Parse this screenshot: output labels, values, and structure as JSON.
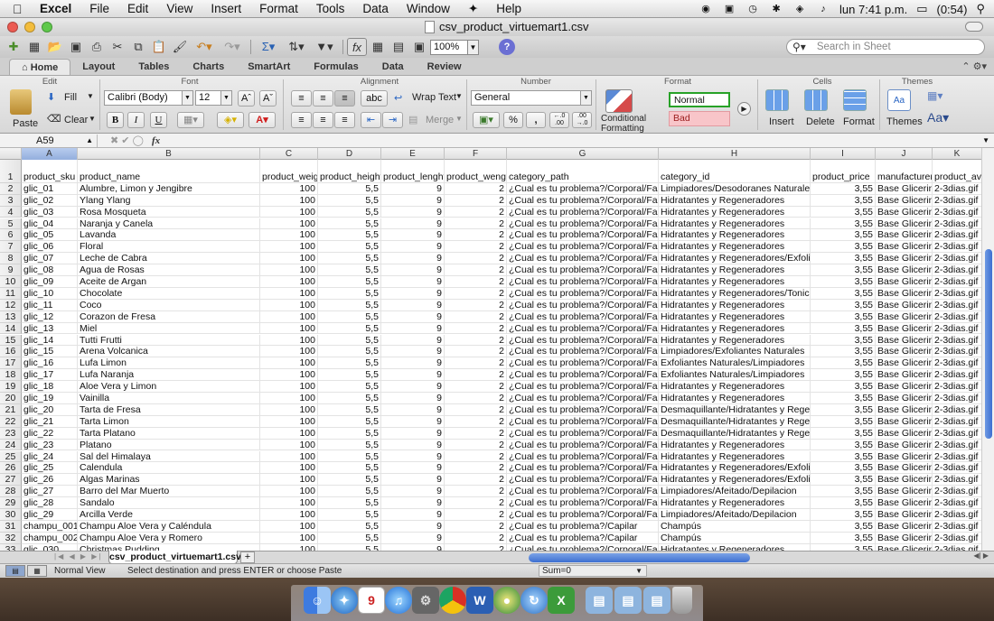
{
  "menubar": {
    "app": "Excel",
    "menus": [
      "File",
      "Edit",
      "View",
      "Insert",
      "Format",
      "Tools",
      "Data",
      "Window",
      "Help"
    ],
    "clock": "lun 7:41 p.m.",
    "battery": "(0:54)"
  },
  "window": {
    "title": "csv_product_virtuemart1.csv"
  },
  "standard_toolbar": {
    "zoom": "100%",
    "search_placeholder": "Search in Sheet"
  },
  "ribbon_tabs": [
    "Home",
    "Layout",
    "Tables",
    "Charts",
    "SmartArt",
    "Formulas",
    "Data",
    "Review"
  ],
  "ribbon": {
    "groups": {
      "edit": "Edit",
      "font": "Font",
      "alignment": "Alignment",
      "number": "Number",
      "format": "Format",
      "cells": "Cells",
      "themes": "Themes"
    },
    "paste": "Paste",
    "fill": "Fill",
    "clear": "Clear",
    "font_name": "Calibri (Body)",
    "font_size": "12",
    "bold": "B",
    "italic": "I",
    "underline": "U",
    "wrap_text": "Wrap Text",
    "merge": "Merge",
    "abc": "abc",
    "number_format": "General",
    "percent": "%",
    "comma": ",",
    "cond_format_line1": "Conditional",
    "cond_format_line2": "Formatting",
    "style_normal": "Normal",
    "style_bad": "Bad",
    "insert": "Insert",
    "delete": "Delete",
    "format": "Format",
    "themes": "Themes"
  },
  "formula_bar": {
    "name_box": "A59",
    "fx": "fx",
    "content": ""
  },
  "columns": [
    {
      "letter": "A",
      "header": "product_sku"
    },
    {
      "letter": "B",
      "header": "product_name"
    },
    {
      "letter": "C",
      "header": "product_weigh"
    },
    {
      "letter": "D",
      "header": "product_height"
    },
    {
      "letter": "E",
      "header": "product_lenght"
    },
    {
      "letter": "F",
      "header": "product_wengh"
    },
    {
      "letter": "G",
      "header": "category_path"
    },
    {
      "letter": "H",
      "header": "category_id"
    },
    {
      "letter": "I",
      "header": "product_price"
    },
    {
      "letter": "J",
      "header": "manufacturer_"
    },
    {
      "letter": "K",
      "header": "product_ava"
    }
  ],
  "rows": [
    [
      "glic_01",
      "Alumbre, Limon y Jengibre",
      "100",
      "5,5",
      "9",
      "2",
      "¿Cual es tu problema?/Corporal/Facial",
      "Limpiadores/Desodoranes Naturales",
      "3,55",
      "Base Glicerina",
      "2-3dias.gif"
    ],
    [
      "glic_02",
      "Ylang Ylang",
      "100",
      "5,5",
      "9",
      "2",
      "¿Cual es tu problema?/Corporal/Facial",
      "Hidratantes y Regeneradores",
      "3,55",
      "Base Glicerina",
      "2-3dias.gif"
    ],
    [
      "glic_03",
      "Rosa Mosqueta",
      "100",
      "5,5",
      "9",
      "2",
      "¿Cual es tu problema?/Corporal/Facial",
      "Hidratantes y Regeneradores",
      "3,55",
      "Base Glicerina",
      "2-3dias.gif"
    ],
    [
      "glic_04",
      "Naranja y Canela",
      "100",
      "5,5",
      "9",
      "2",
      "¿Cual es tu problema?/Corporal/Facial",
      "Hidratantes y Regeneradores",
      "3,55",
      "Base Glicerina",
      "2-3dias.gif"
    ],
    [
      "glic_05",
      "Lavanda",
      "100",
      "5,5",
      "9",
      "2",
      "¿Cual es tu problema?/Corporal/Facial",
      "Hidratantes y Regeneradores",
      "3,55",
      "Base Glicerina",
      "2-3dias.gif"
    ],
    [
      "glic_06",
      "Floral",
      "100",
      "5,5",
      "9",
      "2",
      "¿Cual es tu problema?/Corporal/Facial",
      "Hidratantes y Regeneradores",
      "3,55",
      "Base Glicerina",
      "2-3dias.gif"
    ],
    [
      "glic_07",
      "Leche de Cabra",
      "100",
      "5,5",
      "9",
      "2",
      "¿Cual es tu problema?/Corporal/Facial",
      "Hidratantes y Regeneradores/Exfoliant",
      "3,55",
      "Base Glicerina",
      "2-3dias.gif"
    ],
    [
      "glic_08",
      "Agua de Rosas",
      "100",
      "5,5",
      "9",
      "2",
      "¿Cual es tu problema?/Corporal/Facial",
      "Hidratantes y Regeneradores",
      "3,55",
      "Base Glicerina",
      "2-3dias.gif"
    ],
    [
      "glic_09",
      "Aceite de Argan",
      "100",
      "5,5",
      "9",
      "2",
      "¿Cual es tu problema?/Corporal/Facial",
      "Hidratantes y Regeneradores",
      "3,55",
      "Base Glicerina",
      "2-3dias.gif"
    ],
    [
      "glic_10",
      "Chocolate",
      "100",
      "5,5",
      "9",
      "2",
      "¿Cual es tu problema?/Corporal/Facial",
      "Hidratantes y Regeneradores/Tonicos",
      "3,55",
      "Base Glicerina",
      "2-3dias.gif"
    ],
    [
      "glic_11",
      "Coco",
      "100",
      "5,5",
      "9",
      "2",
      "¿Cual es tu problema?/Corporal/Facial",
      "Hidratantes y Regeneradores",
      "3,55",
      "Base Glicerina",
      "2-3dias.gif"
    ],
    [
      "glic_12",
      "Corazon de Fresa",
      "100",
      "5,5",
      "9",
      "2",
      "¿Cual es tu problema?/Corporal/Facial",
      "Hidratantes y Regeneradores",
      "3,55",
      "Base Glicerina",
      "2-3dias.gif"
    ],
    [
      "glic_13",
      "Miel",
      "100",
      "5,5",
      "9",
      "2",
      "¿Cual es tu problema?/Corporal/Facial",
      "Hidratantes y Regeneradores",
      "3,55",
      "Base Glicerina",
      "2-3dias.gif"
    ],
    [
      "glic_14",
      "Tutti Frutti",
      "100",
      "5,5",
      "9",
      "2",
      "¿Cual es tu problema?/Corporal/Facial",
      "Hidratantes y Regeneradores",
      "3,55",
      "Base Glicerina",
      "2-3dias.gif"
    ],
    [
      "glic_15",
      "Arena Volcanica",
      "100",
      "5,5",
      "9",
      "2",
      "¿Cual es tu problema?/Corporal/Facial",
      "Limpiadores/Exfoliantes Naturales",
      "3,55",
      "Base Glicerina",
      "2-3dias.gif"
    ],
    [
      "glic_16",
      "Lufa Limon",
      "100",
      "5,5",
      "9",
      "2",
      "¿Cual es tu problema?/Corporal/Facial",
      "Exfoliantes Naturales/Limpiadores",
      "3,55",
      "Base Glicerina",
      "2-3dias.gif"
    ],
    [
      "glic_17",
      "Lufa Naranja",
      "100",
      "5,5",
      "9",
      "2",
      "¿Cual es tu problema?/Corporal/Facial",
      "Exfoliantes Naturales/Limpiadores",
      "3,55",
      "Base Glicerina",
      "2-3dias.gif"
    ],
    [
      "glic_18",
      "Aloe Vera y Limon",
      "100",
      "5,5",
      "9",
      "2",
      "¿Cual es tu problema?/Corporal/Facial",
      "Hidratantes y Regeneradores",
      "3,55",
      "Base Glicerina",
      "2-3dias.gif"
    ],
    [
      "glic_19",
      "Vainilla",
      "100",
      "5,5",
      "9",
      "2",
      "¿Cual es tu problema?/Corporal/Facial",
      "Hidratantes y Regeneradores",
      "3,55",
      "Base Glicerina",
      "2-3dias.gif"
    ],
    [
      "glic_20",
      "Tarta de Fresa",
      "100",
      "5,5",
      "9",
      "2",
      "¿Cual es tu problema?/Corporal/Facial",
      "Desmaquillante/Hidratantes y Regener",
      "3,55",
      "Base Glicerina",
      "2-3dias.gif"
    ],
    [
      "glic_21",
      "Tarta Limon",
      "100",
      "5,5",
      "9",
      "2",
      "¿Cual es tu problema?/Corporal/Facial",
      "Desmaquillante/Hidratantes y Regener",
      "3,55",
      "Base Glicerina",
      "2-3dias.gif"
    ],
    [
      "glic_22",
      "Tarta Platano",
      "100",
      "5,5",
      "9",
      "2",
      "¿Cual es tu problema?/Corporal/Facial",
      "Desmaquillante/Hidratantes y Regener",
      "3,55",
      "Base Glicerina",
      "2-3dias.gif"
    ],
    [
      "glic_23",
      "Platano",
      "100",
      "5,5",
      "9",
      "2",
      "¿Cual es tu problema?/Corporal/Facial",
      "Hidratantes y Regeneradores",
      "3,55",
      "Base Glicerina",
      "2-3dias.gif"
    ],
    [
      "glic_24",
      "Sal del Himalaya",
      "100",
      "5,5",
      "9",
      "2",
      "¿Cual es tu problema?/Corporal/Facial",
      "Hidratantes y Regeneradores",
      "3,55",
      "Base Glicerina",
      "2-3dias.gif"
    ],
    [
      "glic_25",
      "Calendula",
      "100",
      "5,5",
      "9",
      "2",
      "¿Cual es tu problema?/Corporal/Facial",
      "Hidratantes y Regeneradores/Exfoliant",
      "3,55",
      "Base Glicerina",
      "2-3dias.gif"
    ],
    [
      "glic_26",
      "Algas Marinas",
      "100",
      "5,5",
      "9",
      "2",
      "¿Cual es tu problema?/Corporal/Facial",
      "Hidratantes y Regeneradores/Exfoliant",
      "3,55",
      "Base Glicerina",
      "2-3dias.gif"
    ],
    [
      "glic_27",
      "Barro del Mar Muerto",
      "100",
      "5,5",
      "9",
      "2",
      "¿Cual es tu problema?/Corporal/Facial",
      "Limpiadores/Afeitado/Depilacion",
      "3,55",
      "Base Glicerina",
      "2-3dias.gif"
    ],
    [
      "glic_28",
      "Sandalo",
      "100",
      "5,5",
      "9",
      "2",
      "¿Cual es tu problema?/Corporal/Facial",
      "Hidratantes y Regeneradores",
      "3,55",
      "Base Glicerina",
      "2-3dias.gif"
    ],
    [
      "glic_29",
      "Arcilla Verde",
      "100",
      "5,5",
      "9",
      "2",
      "¿Cual es tu problema?/Corporal/Facial",
      "Limpiadores/Afeitado/Depilacion",
      "3,55",
      "Base Glicerina",
      "2-3dias.gif"
    ],
    [
      "champu_001",
      "Champu Aloe Vera y Caléndula",
      "100",
      "5,5",
      "9",
      "2",
      "¿Cual es tu problema?/Capilar",
      "Champús",
      "3,55",
      "Base Glicerina",
      "2-3dias.gif"
    ],
    [
      "champu_002",
      "Champu Aloe Vera y Romero",
      "100",
      "5,5",
      "9",
      "2",
      "¿Cual es tu problema?/Capilar",
      "Champús",
      "3,55",
      "Base Glicerina",
      "2-3dias.gif"
    ],
    [
      "glic_030",
      "Christmas Pudding",
      "100",
      "5,5",
      "9",
      "2",
      "¿Cual es tu problema?/Corporal/Facial",
      "Hidratantes y Regeneradores",
      "3,55",
      "Base Glicerina",
      "2-3dias.gif"
    ]
  ],
  "sheet_tab": "csv_product_virtuemart1.csv",
  "status": {
    "view": "Normal View",
    "message": "Select destination and press ENTER or choose Paste",
    "sum": "Sum=0"
  },
  "icons": [
    "apple-icon",
    "wifi-icon",
    "bluetooth-icon",
    "volume-icon",
    "search-icon",
    "finder-icon",
    "safari-icon",
    "calendar-icon",
    "itunes-icon",
    "chrome-icon",
    "word-icon",
    "excel-icon",
    "trash-icon"
  ]
}
